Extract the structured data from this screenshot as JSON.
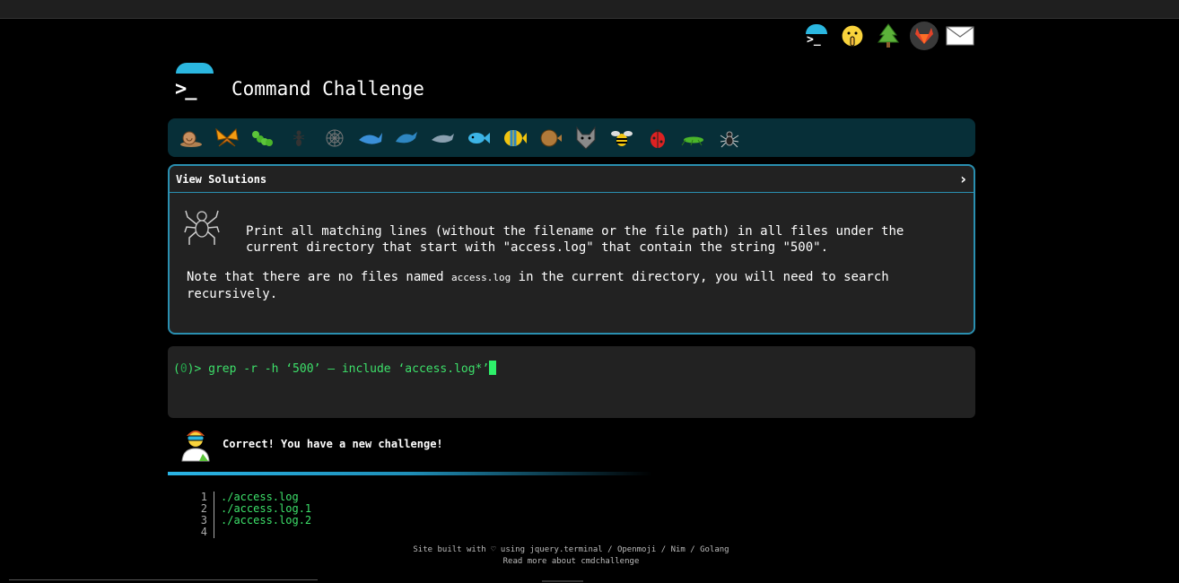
{
  "site": {
    "title": "Command Challenge",
    "logo_prompt": ">_"
  },
  "top_icons": [
    "terminal-icon",
    "shushing-face-icon",
    "tree-icon",
    "gitlab-icon",
    "envelope-icon"
  ],
  "levels": [
    "snail",
    "butterfly",
    "caterpillar",
    "ant",
    "spider-web",
    "whale",
    "dolphin",
    "dolphin-grey",
    "fish",
    "tropical-fish",
    "blowfish",
    "wolf",
    "bee",
    "ladybug",
    "cricket",
    "spider"
  ],
  "challenge": {
    "header": "View Solutions",
    "text": "Print all matching lines (without the filename or the file path) in all files under the current directory that start with \"access.log\" that contain the string \"500\".",
    "note_before": "Note that there are no files named ",
    "note_code": "access.log",
    "note_after": " in the current directory, you will need to search recursively."
  },
  "terminal": {
    "prompt_prefix": "(",
    "prompt_num": "0",
    "prompt_suffix": ")> ",
    "command": "grep -r -h ‘500’ — include ‘access.log*’"
  },
  "result": {
    "message": "Correct! You have a new challenge!"
  },
  "output": {
    "lines": [
      {
        "num": "1",
        "text": "./access.log"
      },
      {
        "num": "2",
        "text": "./access.log.1"
      },
      {
        "num": "3",
        "text": "./access.log.2"
      },
      {
        "num": "4",
        "text": ""
      }
    ]
  },
  "footer": {
    "line1": "Site built with ♡ using jquery.terminal / Openmoji / Nim / Golang",
    "line2": "Read more about cmdchallenge"
  },
  "colors": {
    "accent": "#2bb7e0",
    "terminal_green": "#3de06a",
    "level_bar": "#072f38",
    "panel": "#222222"
  }
}
